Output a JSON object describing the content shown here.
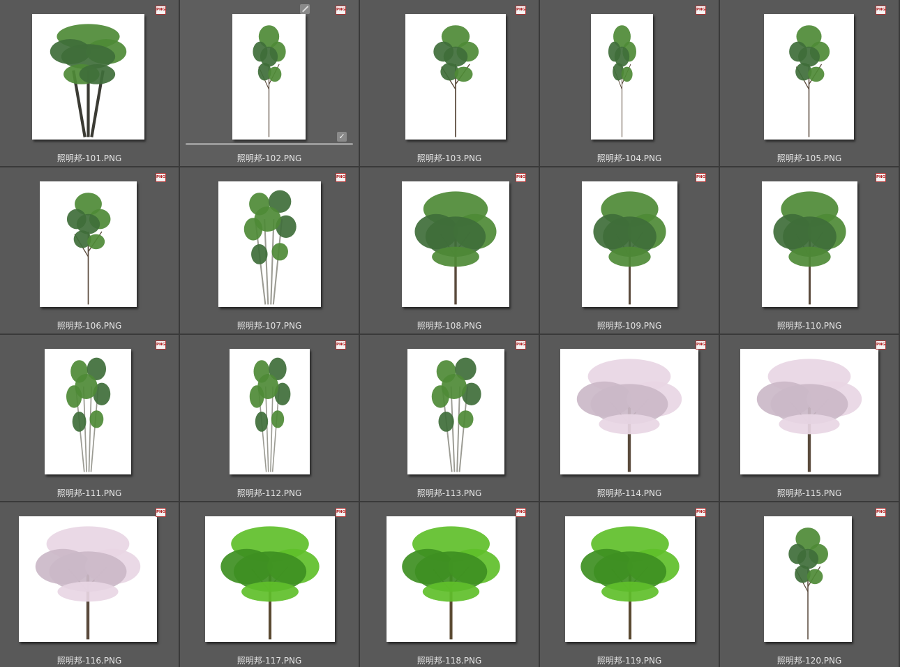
{
  "file_browser": {
    "badge_label": "PNG",
    "items": [
      {
        "filename": "照明邦-101.PNG",
        "tree": "green"
      },
      {
        "filename": "照明邦-102.PNG",
        "tree": "sparse",
        "selected": true,
        "progress": 1.0
      },
      {
        "filename": "照明邦-103.PNG",
        "tree": "sparse"
      },
      {
        "filename": "照明邦-104.PNG",
        "tree": "sparse"
      },
      {
        "filename": "照明邦-105.PNG",
        "tree": "tall"
      },
      {
        "filename": "照明邦-106.PNG",
        "tree": "tall"
      },
      {
        "filename": "照明邦-107.PNG",
        "tree": "multi"
      },
      {
        "filename": "照明邦-108.PNG",
        "tree": "round"
      },
      {
        "filename": "照明邦-109.PNG",
        "tree": "round"
      },
      {
        "filename": "照明邦-110.PNG",
        "tree": "round"
      },
      {
        "filename": "照明邦-111.PNG",
        "tree": "multi"
      },
      {
        "filename": "照明邦-112.PNG",
        "tree": "multi"
      },
      {
        "filename": "照明邦-113.PNG",
        "tree": "multi"
      },
      {
        "filename": "照明邦-114.PNG",
        "tree": "blossom"
      },
      {
        "filename": "照明邦-115.PNG",
        "tree": "blossom"
      },
      {
        "filename": "照明邦-116.PNG",
        "tree": "blossom"
      },
      {
        "filename": "照明邦-117.PNG",
        "tree": "bright"
      },
      {
        "filename": "照明邦-118.PNG",
        "tree": "bright"
      },
      {
        "filename": "照明邦-119.PNG",
        "tree": "bright"
      },
      {
        "filename": "照明邦-120.PNG",
        "tree": "sparse"
      }
    ]
  },
  "colors": {
    "background": "#595959",
    "filename_text": "#e4e4e4",
    "badge_red": "#b01e1e",
    "foliage_green": "#4e8a36",
    "foliage_bright": "#5fbf2a",
    "foliage_dark": "#3f6e3a",
    "blossom_pink": "#e8d6e4",
    "trunk": "#5a4a3c"
  }
}
